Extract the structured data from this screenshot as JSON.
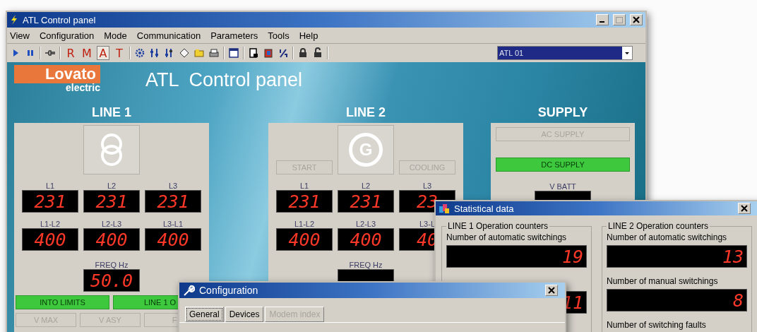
{
  "window": {
    "title": "ATL Control panel"
  },
  "menu": [
    "View",
    "Configuration",
    "Mode",
    "Communication",
    "Parameters",
    "Tools",
    "Help"
  ],
  "toolbar": {
    "modes": [
      {
        "label": "R",
        "selected": false
      },
      {
        "label": "M",
        "selected": false
      },
      {
        "label": "A",
        "selected": true
      },
      {
        "label": "T",
        "selected": false
      }
    ],
    "device": "ATL 01"
  },
  "header": {
    "logo_top": "Lovato",
    "logo_bottom": "electric",
    "title": "ATL  Control panel"
  },
  "lines": [
    {
      "heading": "LINE 1",
      "kind": "transformer",
      "phase": [
        {
          "label": "L1",
          "value": "231"
        },
        {
          "label": "L2",
          "value": "231"
        },
        {
          "label": "L3",
          "value": "231"
        }
      ],
      "linked": [
        {
          "label": "L1-L2",
          "value": "400"
        },
        {
          "label": "L2-L3",
          "value": "400"
        },
        {
          "label": "L3-L1",
          "value": "400"
        }
      ],
      "freq": {
        "label": "FREQ Hz",
        "value": "50.0"
      },
      "status": [
        {
          "label": "INTO LIMITS",
          "on": true
        },
        {
          "label": "LINE 1 O",
          "on": true
        }
      ],
      "alarms": [
        {
          "label": "V MAX",
          "on": false
        },
        {
          "label": "V ASY",
          "on": false
        },
        {
          "label": "F",
          "on": false
        }
      ]
    },
    {
      "heading": "LINE 2",
      "kind": "generator",
      "symbol": "G",
      "indicators": [
        {
          "label": "START",
          "on": false
        },
        {
          "label": "COOLING",
          "on": false
        }
      ],
      "phase": [
        {
          "label": "L1",
          "value": "231"
        },
        {
          "label": "L2",
          "value": "231"
        },
        {
          "label": "L3",
          "value": "23"
        }
      ],
      "linked": [
        {
          "label": "L1-L2",
          "value": "400"
        },
        {
          "label": "L2-L3",
          "value": "400"
        },
        {
          "label": "L3-L",
          "value": "40"
        }
      ],
      "freq": {
        "label": "FREQ Hz"
      }
    }
  ],
  "supply": {
    "heading": "SUPPLY",
    "indicators": [
      {
        "label": "AC SUPPLY",
        "on": false
      },
      {
        "label": "DC SUPPLY",
        "on": true
      }
    ],
    "battery": {
      "label": "V BATT"
    }
  },
  "statistics": {
    "title": "Statistical data",
    "groups": [
      {
        "title": "LINE 1 Operation counters",
        "counters": [
          {
            "label": "Number of automatic switchings",
            "value": "19"
          },
          {
            "value": "11"
          }
        ]
      },
      {
        "title": "LINE 2 Operation counters",
        "counters": [
          {
            "label": "Number of automatic switchings",
            "value": "13"
          },
          {
            "label": "Number of manual switchings",
            "value": "8"
          },
          {
            "label": "Number of switching faults"
          }
        ]
      }
    ]
  },
  "configuration": {
    "title": "Configuration",
    "tabs": [
      {
        "label": "General",
        "selected": true,
        "disabled": false
      },
      {
        "label": "Devices",
        "selected": false,
        "disabled": false
      },
      {
        "label": "Modem index",
        "selected": false,
        "disabled": true
      }
    ]
  }
}
